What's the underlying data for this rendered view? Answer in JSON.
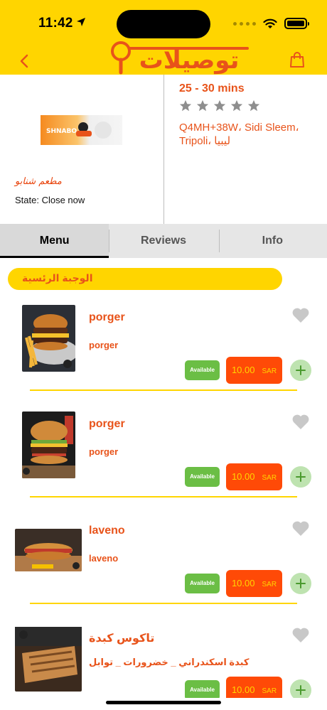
{
  "status_bar": {
    "time": "11:42"
  },
  "header": {
    "logo_text": "توصيلات"
  },
  "restaurant": {
    "logo_text": "SHNABO",
    "name": "مطعم شنابو",
    "state": "State: Close now",
    "eta": "25 - 30 mins",
    "rating": 0,
    "address": "Q4MH+38W، Sidi Sleem، Tripoli، ليبيا"
  },
  "tabs": [
    {
      "label": "Menu"
    },
    {
      "label": "Reviews"
    },
    {
      "label": "Info"
    }
  ],
  "category": {
    "title": "الوجبة الرئسية"
  },
  "items": [
    {
      "title": "porger",
      "description": "porger",
      "status": "Available",
      "price": "10.00",
      "currency": "SAR"
    },
    {
      "title": "porger",
      "description": "porger",
      "status": "Available",
      "price": "10.00",
      "currency": "SAR"
    },
    {
      "title": "laveno",
      "description": "laveno",
      "status": "Available",
      "price": "10.00",
      "currency": "SAR"
    },
    {
      "title": "تاكوس كبدة",
      "description": "كبدة اسكندراني _ خضرورات _ توابل",
      "status": "Available",
      "price": "10.00",
      "currency": "SAR"
    }
  ],
  "colors": {
    "brand_yellow": "#FFD500",
    "brand_orange": "#E8531A",
    "price_bg": "#FF4A07",
    "available_green": "#6BBE45"
  }
}
